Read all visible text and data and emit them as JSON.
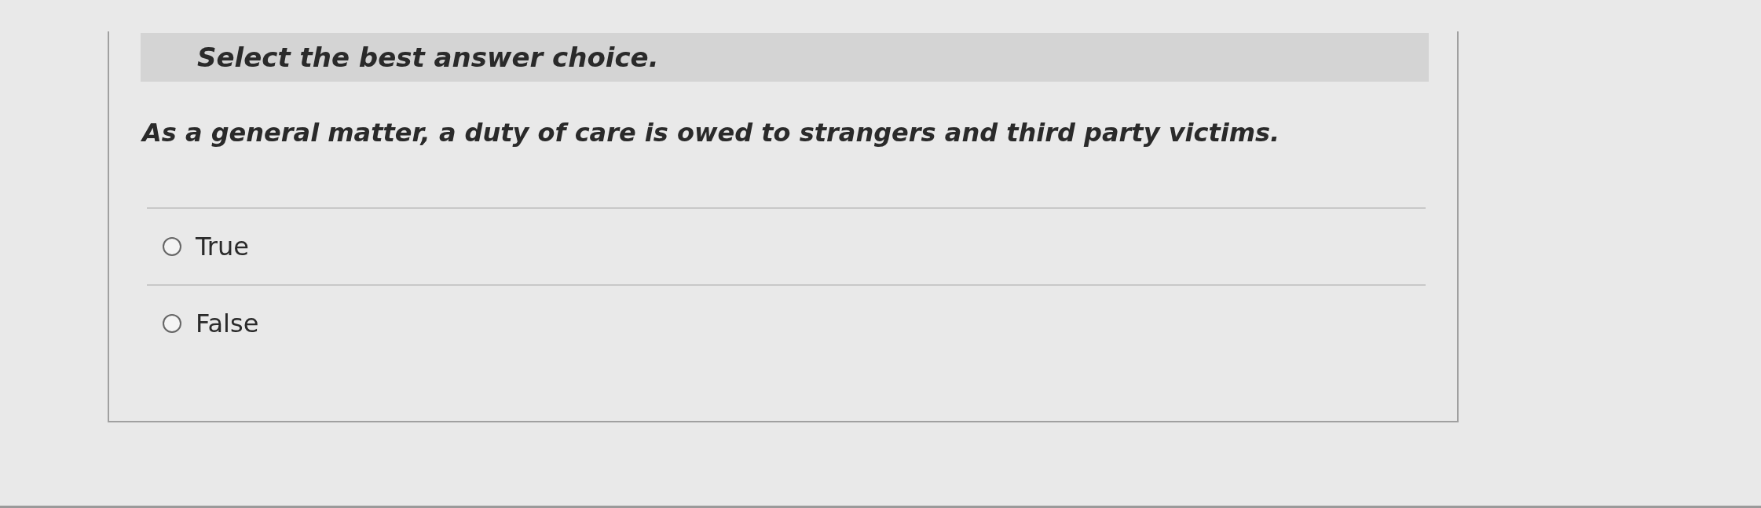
{
  "instruction": "Select the best answer choice.",
  "question": "As a general matter, a duty of care is owed to strangers and third party victims.",
  "options": [
    {
      "label": "True",
      "selected": false
    },
    {
      "label": "False",
      "selected": false
    }
  ]
}
